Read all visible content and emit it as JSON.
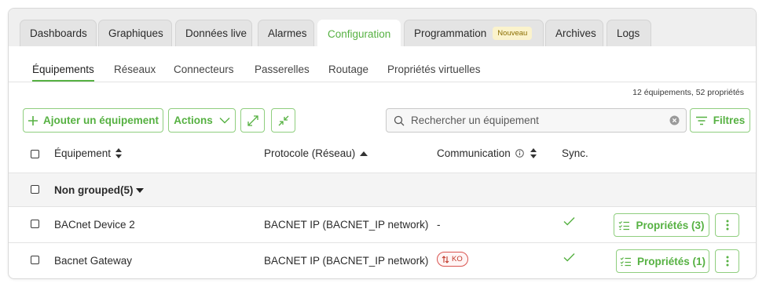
{
  "tabs": [
    {
      "label": "Dashboards"
    },
    {
      "label": "Graphiques"
    },
    {
      "label": "Données live"
    },
    {
      "label": "Alarmes"
    },
    {
      "label": "Configuration",
      "active": true
    },
    {
      "label": "Programmation",
      "badge": "Nouveau"
    },
    {
      "label": "Archives"
    },
    {
      "label": "Logs"
    }
  ],
  "subtabs": [
    {
      "label": "Équipements",
      "active": true
    },
    {
      "label": "Réseaux"
    },
    {
      "label": "Connecteurs"
    },
    {
      "label": "Passerelles"
    },
    {
      "label": "Routage"
    },
    {
      "label": "Propriétés virtuelles"
    }
  ],
  "summary": "12 équipements, 52 propriétés",
  "toolbar": {
    "add_label": "Ajouter un équipement",
    "actions_label": "Actions",
    "search_placeholder": "Rechercher un équipement",
    "filters_label": "Filtres"
  },
  "table": {
    "headers": {
      "equipment": "Équipement",
      "protocol": "Protocole (Réseau)",
      "communication": "Communication",
      "sync": "Sync."
    },
    "group": {
      "label": "Non grouped(5)"
    },
    "rows": [
      {
        "name": "BACnet Device 2",
        "protocol": "BACNET IP (BACNET_IP network)",
        "communication": "-",
        "sync": "check",
        "properties_label": "Propriétés (3)"
      },
      {
        "name": "Bacnet Gateway",
        "protocol": "BACNET IP (BACNET_IP network)",
        "communication": "KO",
        "sync": "check",
        "properties_label": "Propriétés (1)"
      }
    ]
  },
  "colors": {
    "accent": "#56b142",
    "danger": "#d9534f",
    "badge_bg": "#fbf3cc"
  }
}
